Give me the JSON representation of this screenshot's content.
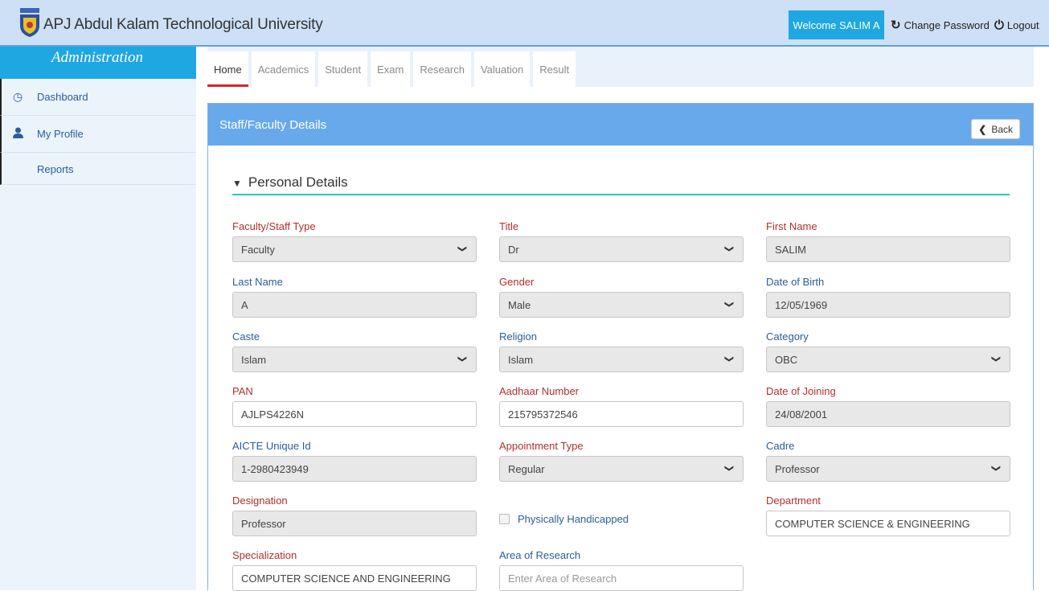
{
  "header": {
    "brand": "APJ Abdul Kalam Technological University",
    "welcome": "Welcome SALIM A",
    "change_password": "Change Password",
    "logout": "Logout"
  },
  "sidebar": {
    "title": "Administration",
    "items": [
      {
        "label": "Dashboard",
        "icon": "dashboard-icon"
      },
      {
        "label": "My Profile",
        "icon": "user-icon"
      },
      {
        "label": "Reports",
        "icon": ""
      }
    ]
  },
  "tabs": [
    "Home",
    "Academics",
    "Student",
    "Exam",
    "Research",
    "Valuation",
    "Result"
  ],
  "panel": {
    "title": "Staff/Faculty Details",
    "back_label": "Back",
    "section_title": "Personal Details"
  },
  "fields": {
    "faculty_type": {
      "label": "Faculty/Staff Type",
      "value": "Faculty"
    },
    "title": {
      "label": "Title",
      "value": "Dr"
    },
    "first_name": {
      "label": "First Name",
      "value": "SALIM"
    },
    "last_name": {
      "label": "Last Name",
      "value": "A"
    },
    "gender": {
      "label": "Gender",
      "value": "Male"
    },
    "dob": {
      "label": "Date of Birth",
      "value": "12/05/1969"
    },
    "caste": {
      "label": "Caste",
      "value": "Islam"
    },
    "religion": {
      "label": "Religion",
      "value": "Islam"
    },
    "category": {
      "label": "Category",
      "value": "OBC"
    },
    "pan": {
      "label": "PAN",
      "value": "AJLPS4226N"
    },
    "aadhaar": {
      "label": "Aadhaar Number",
      "value": "215795372546"
    },
    "doj": {
      "label": "Date of Joining",
      "value": "24/08/2001"
    },
    "aicte": {
      "label": "AICTE Unique Id",
      "value": "1-2980423949"
    },
    "appointment": {
      "label": "Appointment Type",
      "value": "Regular"
    },
    "cadre": {
      "label": "Cadre",
      "value": "Professor"
    },
    "designation": {
      "label": "Designation",
      "value": "Professor"
    },
    "handicapped": {
      "label": "Physically Handicapped"
    },
    "department": {
      "label": "Department",
      "value": "COMPUTER SCIENCE & ENGINEERING"
    },
    "specialization": {
      "label": "Specialization",
      "value": "COMPUTER SCIENCE AND ENGINEERING"
    },
    "research": {
      "label": "Area of Research",
      "placeholder": "Enter Area of Research"
    }
  },
  "colors": {
    "accent": "#1ea7e0",
    "panel_header": "#68a9ec",
    "required_label": "#b0302d",
    "optional_label": "#2a5d9c",
    "section_rule": "#2bc4c8"
  }
}
